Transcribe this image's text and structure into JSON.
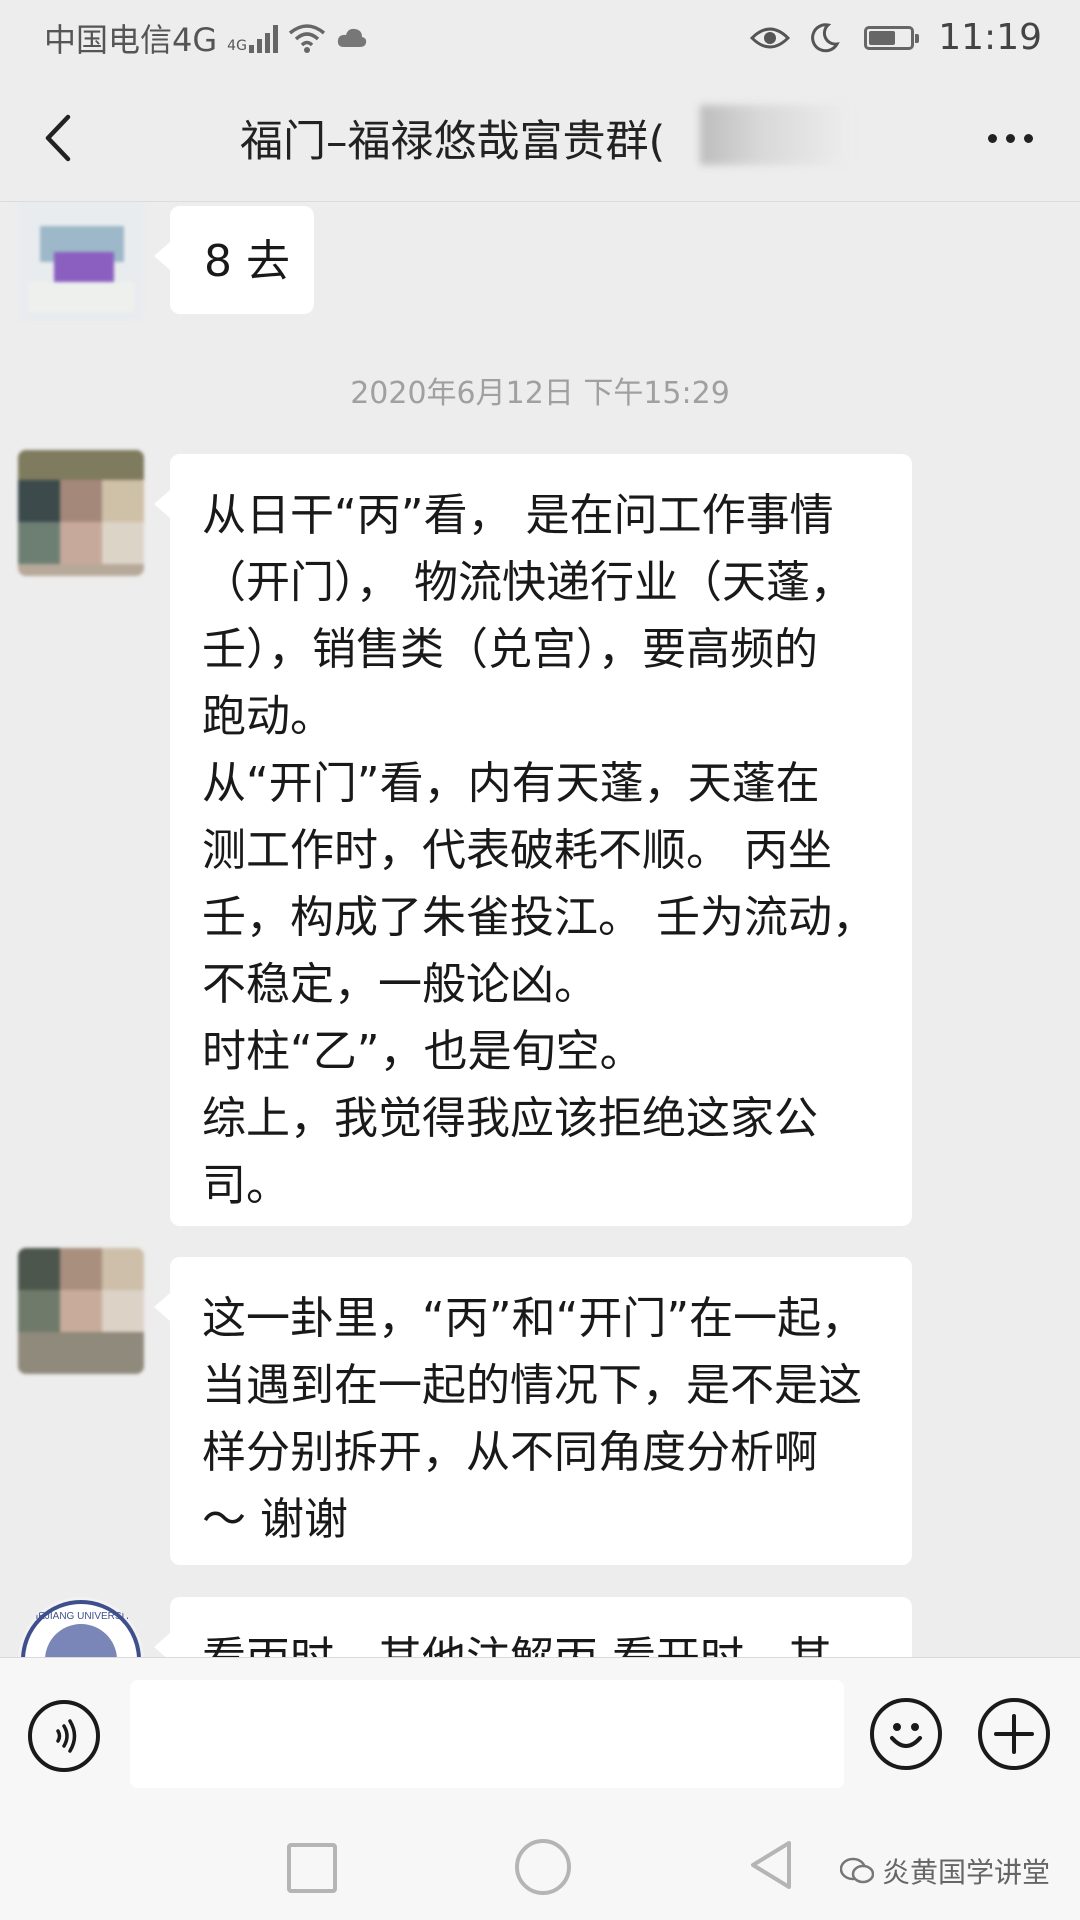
{
  "status_bar": {
    "carrier": "中国电信4G",
    "network_badge": "4G",
    "time": "11:19",
    "icons": [
      "signal-icon",
      "wifi-icon",
      "cloud-icon",
      "eye-icon",
      "moon-icon",
      "battery-icon"
    ]
  },
  "header": {
    "title": "福门–福禄悠哉富贵群(",
    "back_icon": "chevron-left-icon",
    "more_icon": "more-dots-icon"
  },
  "messages": [
    {
      "text": "8 去"
    },
    {
      "text": "从日干“丙”看， 是在问工作事情\n（开门）， 物流快递行业（天蓬，\n壬），销售类（兑宫），要高频的\n跑动。\n从“开门”看，内有天蓬，天蓬在\n测工作时，代表破耗不顺。 丙坐\n壬，构成了朱雀投江。 壬为流动，\n不稳定，一般论凶。\n时柱“乙”，也是旬空。\n综上，我觉得我应该拒绝这家公\n司。"
    },
    {
      "text": "这一卦里，“丙”和“开门”在一起，\n当遇到在一起的情况下，是不是这\n样分别拆开，从不同角度分析啊\n～ 谢谢"
    },
    {
      "text": "看丙时，其他注解丙  看开时，其"
    }
  ],
  "timestamp": "2020年6月12日 下午15:29",
  "avatar_label": "ZHEJIANG UNIVERSITY",
  "input_bar": {
    "voice_icon": "voice-icon",
    "emoji_icon": "emoji-icon",
    "plus_icon": "plus-icon",
    "text_value": ""
  },
  "nav_bar": {
    "icons": [
      "recent-apps-icon",
      "home-icon",
      "back-icon"
    ],
    "watermark": "炎黄国学讲堂"
  }
}
